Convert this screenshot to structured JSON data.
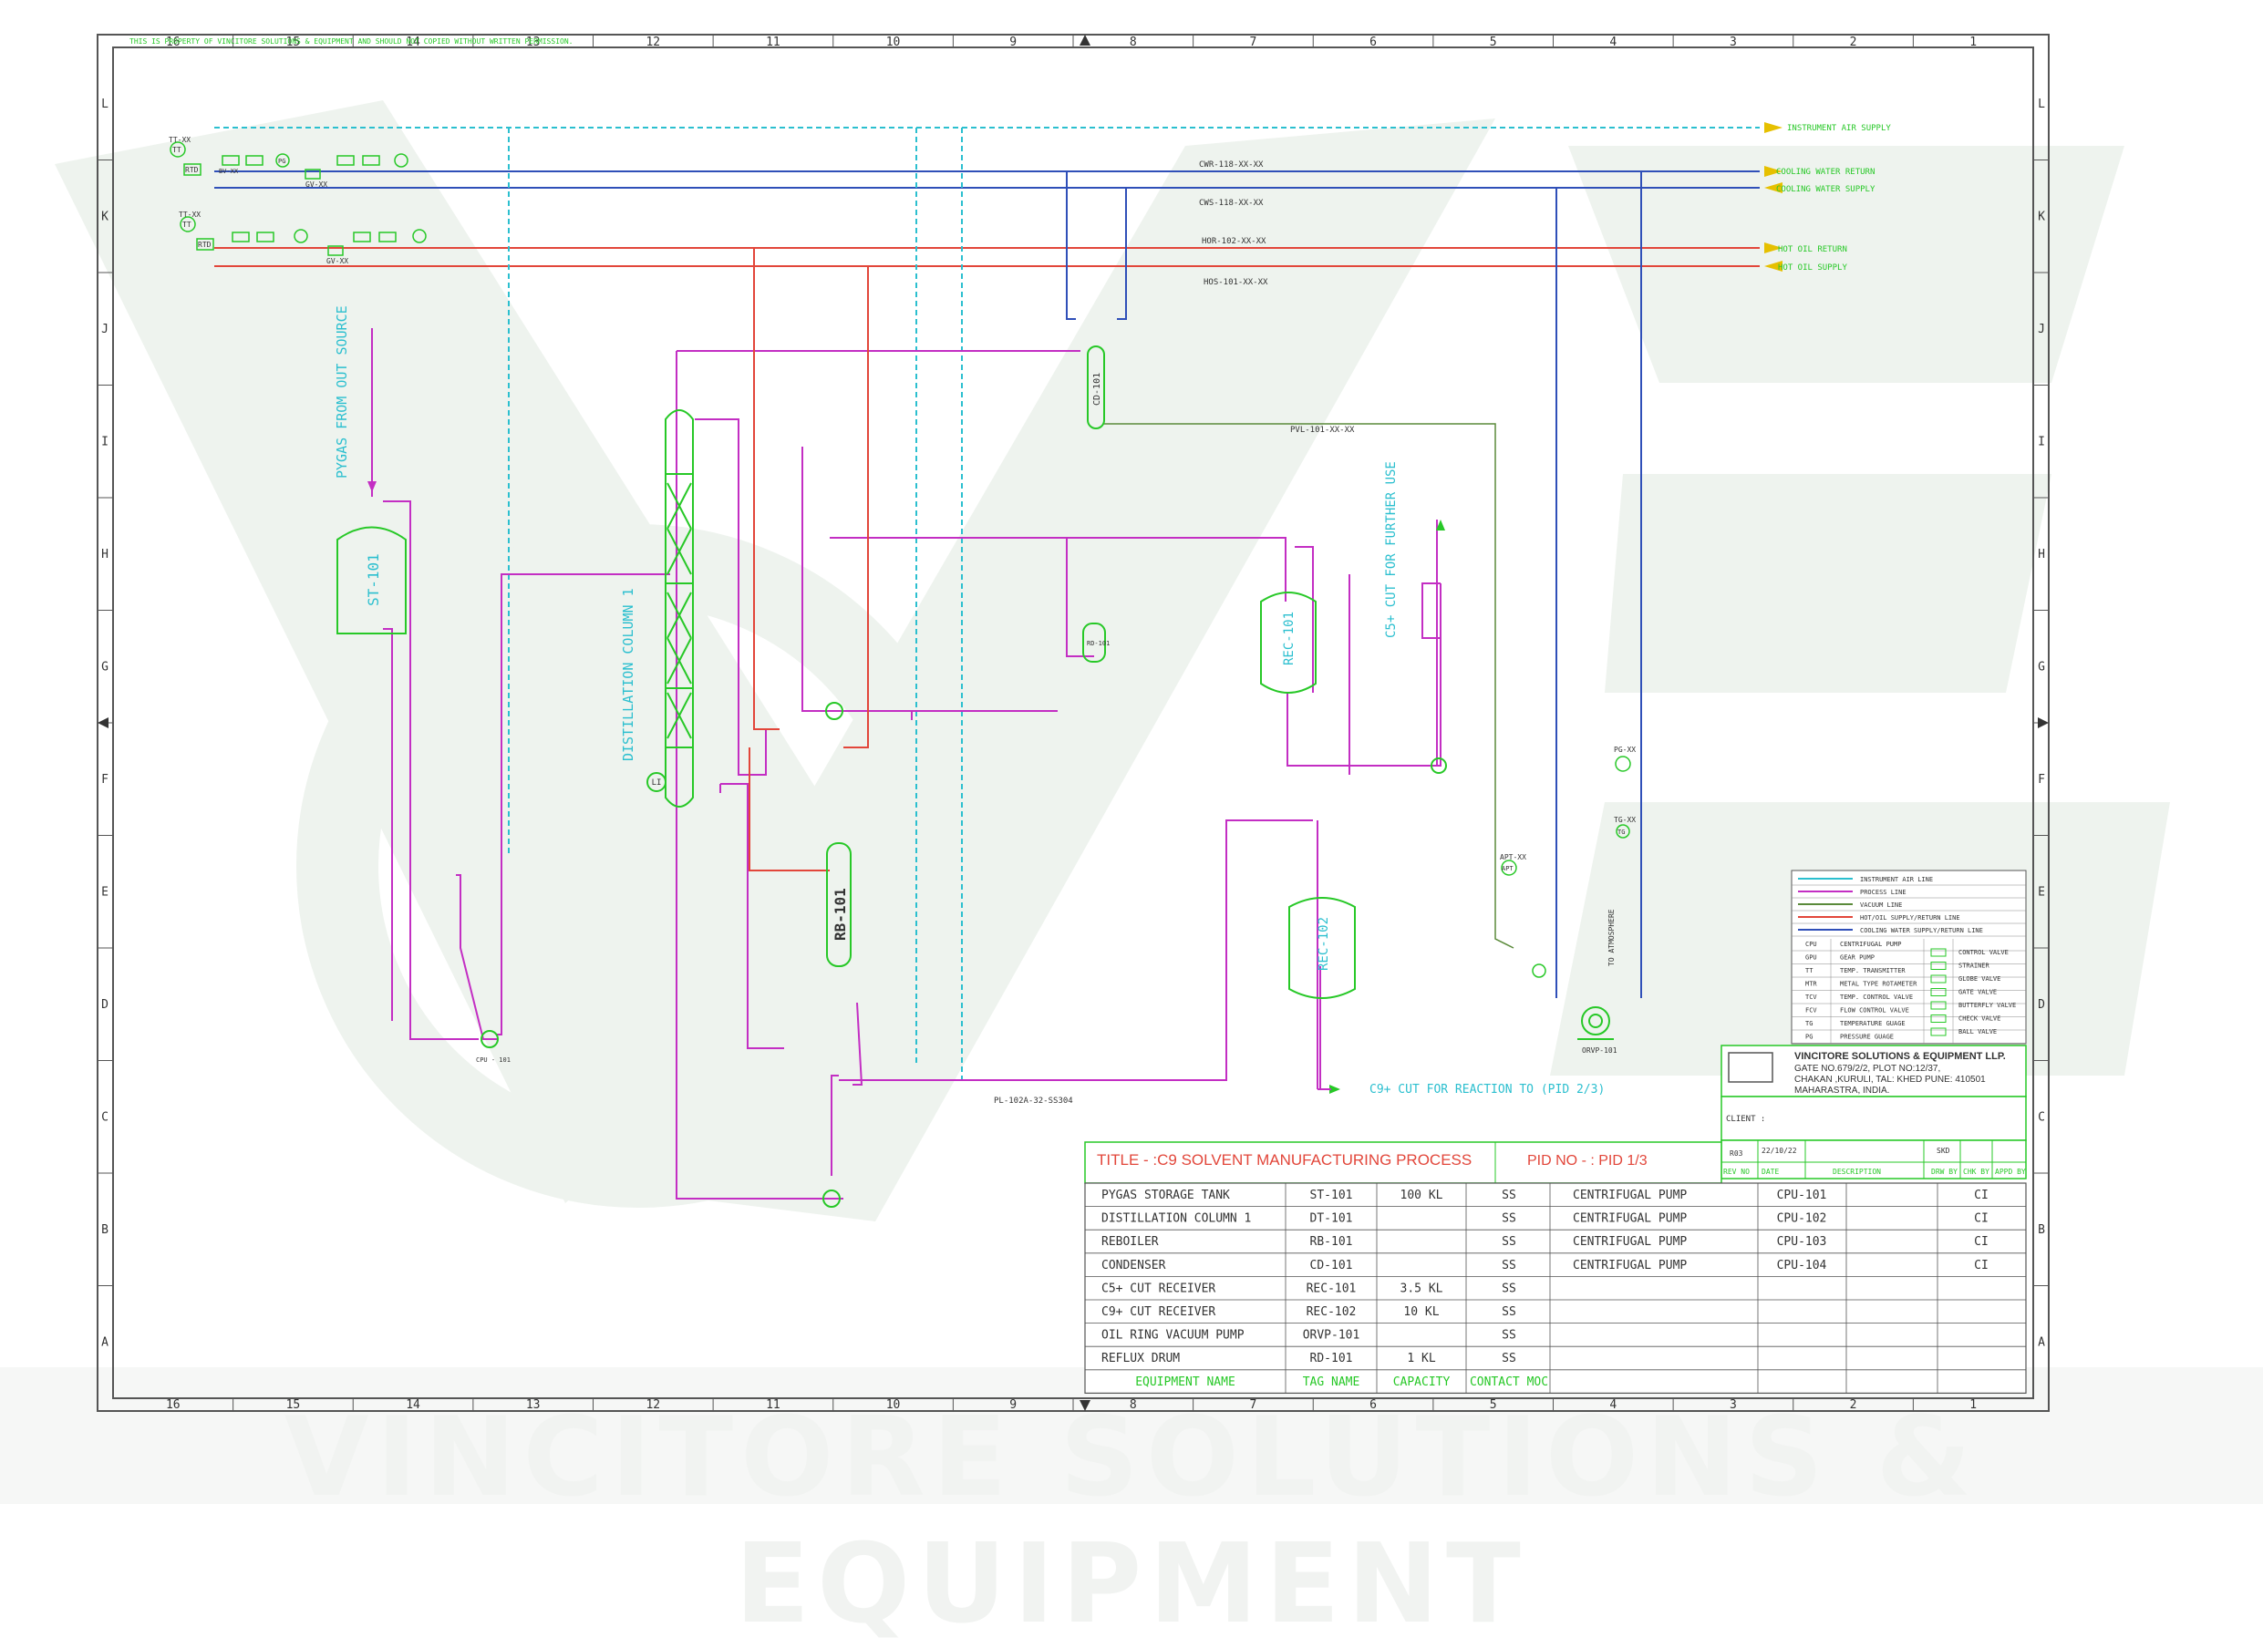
{
  "watermark": {
    "text": "VINCITORE SOLUTIONS & EQUIPMENT"
  },
  "sheet": {
    "notice": "THIS IS PROPERTY OF VINCITORE SOLUTIONS & EQUIPMENT AND SHOULD NOT COPIED WITHOUT WRITTEN PERMISSION.",
    "column_numbers": [
      "16",
      "15",
      "14",
      "13",
      "12",
      "11",
      "10",
      "9",
      "8",
      "7",
      "6",
      "5",
      "4",
      "3",
      "2",
      "1"
    ],
    "row_letters": [
      "L",
      "K",
      "J",
      "I",
      "H",
      "G",
      "F",
      "E",
      "D",
      "C",
      "B",
      "A"
    ]
  },
  "utility_lines": {
    "instrument_air": "INSTRUMENT AIR SUPPLY",
    "cooling_return_tag": "CWR-118-XX-XX",
    "cooling_return": "COOLING WATER RETURN",
    "cooling_supply_tag": "CWS-118-XX-XX",
    "cooling_supply": "COOLING WATER SUPPLY",
    "hot_oil_return_tag": "HOR-102-XX-XX",
    "hot_oil_return": "HOT OIL RETURN",
    "hot_oil_supply_tag": "HOS-101-XX-XX",
    "hot_oil_supply": "HOT OIL SUPPLY"
  },
  "instruments": {
    "tt1": "TT-XX",
    "tt": "TT",
    "rtd": "RTD",
    "bv": "BV-XX",
    "gv": "GV-XX",
    "pg": "PG",
    "li": "LI",
    "apt_tag": "APT-XX",
    "apt": "APT",
    "pg_tag": "PG-XX",
    "tg_tag": "TG-XX",
    "tg": "TG"
  },
  "process": {
    "pygas_source": "PYGAS FROM OUT SOURCE",
    "c5_cut": "C5+ CUT FOR FURTHER USE",
    "c9_cut": "C9+ CUT FOR REACTION TO (PID 2/3)",
    "vacuum_tag": "PVL-101-XX-XX",
    "process_tag": "PL-102A-32-SS304",
    "atmosphere": "TO ATMOSPHERE"
  },
  "equipment_labels": {
    "st101": "ST-101",
    "column": "DISTILLATION COLUMN 1",
    "cd101": "CD-101",
    "rb101": "RB-101",
    "rd101": "RD-101",
    "rec101": "REC-101",
    "rec102": "REC-102",
    "orvp101": "ORVP-101",
    "cpu101": "CPU - 101"
  },
  "legend": {
    "lines": [
      {
        "label": "INSTRUMENT AIR LINE",
        "color": "#2bbfcf"
      },
      {
        "label": "PROCESS LINE",
        "color": "#c32ec3"
      },
      {
        "label": "VACUUM LINE",
        "color": "#5a8a3a"
      },
      {
        "label": "HOT/OIL SUPPLY/RETURN LINE",
        "color": "#e2463a"
      },
      {
        "label": "COOLING WATER SUPPLY/RETURN LINE",
        "color": "#2f4fb8"
      }
    ],
    "abbreviations": [
      {
        "code": "CPU",
        "desc": "CENTRIFUGAL PUMP"
      },
      {
        "code": "GPU",
        "desc": "GEAR PUMP"
      },
      {
        "code": "TT",
        "desc": "TEMP. TRANSMITTER"
      },
      {
        "code": "MTR",
        "desc": "METAL TYPE ROTAMETER"
      },
      {
        "code": "TCV",
        "desc": "TEMP. CONTROL VALVE"
      },
      {
        "code": "FCV",
        "desc": "FLOW CONTROL VALVE"
      },
      {
        "code": "TG",
        "desc": "TEMPERATURE GUAGE"
      },
      {
        "code": "PG",
        "desc": "PRESSURE GUAGE"
      }
    ],
    "valves": [
      "CONTROL VALVE",
      "STRAINER",
      "GLOBE VALVE",
      "GATE VALVE",
      "BUTTERFLY VALVE",
      "CHECK VALVE",
      "BALL VALVE"
    ]
  },
  "title_block": {
    "company": "VINCITORE SOLUTIONS & EQUIPMENT LLP.",
    "address1": "GATE NO.679/2/2, PLOT NO:12/37,",
    "address2": "CHAKAN ,KURULI, TAL: KHED PUNE: 410501",
    "address3": "MAHARASTRA, INDIA.",
    "client": "CLIENT :",
    "title": "TITLE - :C9 SOLVENT MANUFACTURING PROCESS",
    "pid_no": "PID NO - : PID 1/3",
    "rev": "R03",
    "date": "22/10/22",
    "drawn_by": "SKD",
    "rev_headers": [
      "REV NO",
      "DATE",
      "DESCRIPTION",
      "DRW BY",
      "CHK BY",
      "APPD BY"
    ]
  },
  "equipment_table": {
    "headers": [
      "EQUIPMENT NAME",
      "TAG NAME",
      "CAPACITY",
      "CONTACT MOC"
    ],
    "rows": [
      {
        "name": "PYGAS STORAGE  TANK",
        "tag": "ST-101",
        "capacity": "100 KL",
        "moc": "SS"
      },
      {
        "name": "DISTILLATION COLUMN 1",
        "tag": "DT-101",
        "capacity": "",
        "moc": "SS"
      },
      {
        "name": "REBOILER",
        "tag": "RB-101",
        "capacity": "",
        "moc": "SS"
      },
      {
        "name": "CONDENSER",
        "tag": "CD-101",
        "capacity": "",
        "moc": "SS"
      },
      {
        "name": "C5+ CUT RECEIVER",
        "tag": "REC-101",
        "capacity": "3.5 KL",
        "moc": "SS"
      },
      {
        "name": "C9+ CUT RECEIVER",
        "tag": "REC-102",
        "capacity": "10 KL",
        "moc": "SS"
      },
      {
        "name": "OIL RING VACUUM PUMP",
        "tag": "ORVP-101",
        "capacity": "",
        "moc": "SS"
      },
      {
        "name": "REFLUX DRUM",
        "tag": "RD-101",
        "capacity": "1 KL",
        "moc": "SS"
      }
    ],
    "pumps": [
      {
        "name": "CENTRIFUGAL PUMP",
        "tag": "CPU-101",
        "moc": "CI"
      },
      {
        "name": "CENTRIFUGAL PUMP",
        "tag": "CPU-102",
        "moc": "CI"
      },
      {
        "name": "CENTRIFUGAL PUMP",
        "tag": "CPU-103",
        "moc": "CI"
      },
      {
        "name": "CENTRIFUGAL PUMP",
        "tag": "CPU-104",
        "moc": "CI"
      }
    ]
  },
  "colors": {
    "frame": "#555555",
    "equipment": "#27c827",
    "label": "#2bbfcf",
    "process": "#c32ec3",
    "hot_oil": "#e2463a",
    "cooling": "#2f4fb8",
    "title": "#e2463a"
  }
}
